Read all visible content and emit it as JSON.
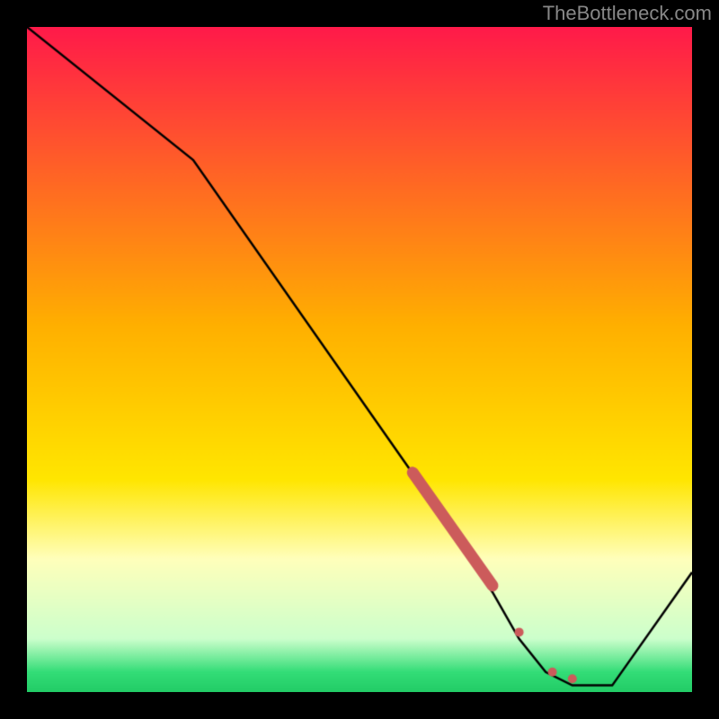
{
  "watermark": "TheBottleneck.com",
  "colors": {
    "top": "#ff1a4a",
    "mid": "#ffd900",
    "pale": "#ffffaa",
    "green": "#22dd77",
    "line": "#000000",
    "marker": "#cc5b5b"
  },
  "chart_data": {
    "type": "line",
    "title": "",
    "xlabel": "",
    "ylabel": "",
    "xlim": [
      0,
      100
    ],
    "ylim": [
      0,
      100
    ],
    "series": [
      {
        "name": "curve",
        "x": [
          0,
          25,
          60,
          70,
          74,
          78,
          82,
          88,
          100
        ],
        "y": [
          100,
          80,
          30,
          15,
          8,
          3,
          1,
          1,
          18
        ]
      }
    ],
    "markers": [
      {
        "shape": "thick-segment",
        "x0": 58,
        "y0": 33,
        "x1": 70,
        "y1": 16
      },
      {
        "shape": "dot",
        "x": 74,
        "y": 9,
        "r": 5
      },
      {
        "shape": "dot",
        "x": 79,
        "y": 3,
        "r": 5
      },
      {
        "shape": "dot",
        "x": 82,
        "y": 2,
        "r": 5
      }
    ],
    "background_gradient": {
      "stops": [
        {
          "pos": 0.0,
          "color": "#ff1a4a"
        },
        {
          "pos": 0.45,
          "color": "#ffb000"
        },
        {
          "pos": 0.68,
          "color": "#ffe600"
        },
        {
          "pos": 0.8,
          "color": "#ffffbb"
        },
        {
          "pos": 0.92,
          "color": "#ccffcc"
        },
        {
          "pos": 0.97,
          "color": "#33dd77"
        },
        {
          "pos": 1.0,
          "color": "#22cc66"
        }
      ]
    }
  }
}
